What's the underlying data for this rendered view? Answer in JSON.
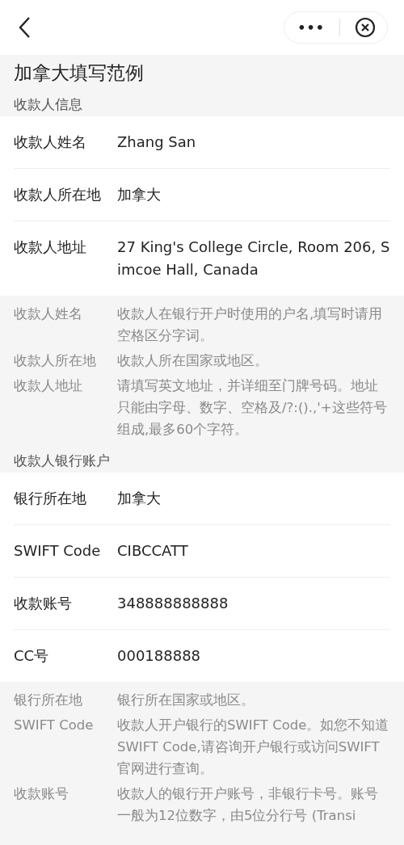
{
  "nav": {
    "more": "•••"
  },
  "title": "加拿大填写范例",
  "sections": [
    {
      "heading": "收款人信息",
      "fields": [
        {
          "label": "收款人姓名",
          "value": "Zhang San"
        },
        {
          "label": "收款人所在地",
          "value": "加拿大"
        },
        {
          "label": "收款人地址",
          "value": "27 King's College Circle, Room 206, Simcoe Hall, Canada"
        }
      ],
      "notes": [
        {
          "label": "收款人姓名",
          "text": "收款人在银行开户时使用的户名,填写时请用空格区分字词。"
        },
        {
          "label": "收款人所在地",
          "text": "收款人所在国家或地区。"
        },
        {
          "label": "收款人地址",
          "text": "请填写英文地址，并详细至门牌号码。地址只能由字母、数字、空格及/?:().,'+这些符号组成,最多60个字符。"
        }
      ]
    },
    {
      "heading": "收款人银行账户",
      "fields": [
        {
          "label": "银行所在地",
          "value": "加拿大"
        },
        {
          "label": "SWIFT Code",
          "value": "CIBCCATT"
        },
        {
          "label": "收款账号",
          "value": "348888888888"
        },
        {
          "label": "CC号",
          "value": "000188888"
        }
      ],
      "notes": [
        {
          "label": "银行所在地",
          "text": "银行所在国家或地区。"
        },
        {
          "label": "SWIFT Code",
          "text": "收款人开户银行的SWIFT Code。如您不知道SWIFT Code,请咨询开户银行或访问SWIFT官网进行查询。"
        },
        {
          "label": "收款账号",
          "text": "收款人的银行开户账号，非银行卡号。账号一般为12位数字，由5位分行号 (Transi"
        }
      ]
    }
  ]
}
